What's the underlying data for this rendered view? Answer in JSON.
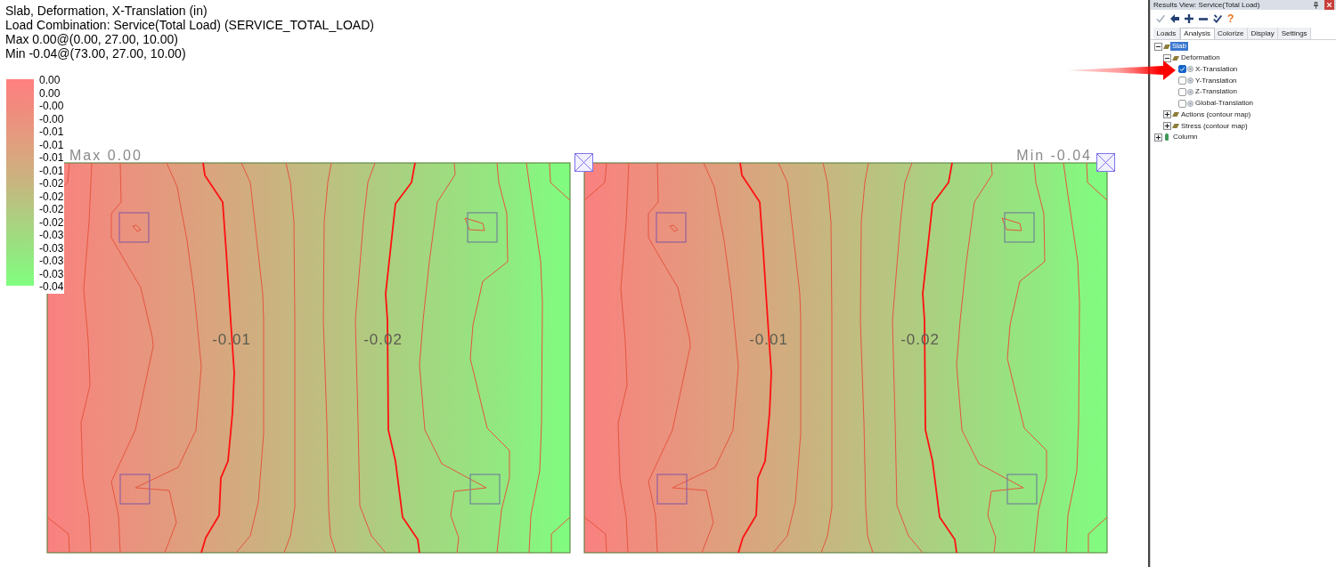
{
  "header": {
    "lines": [
      "Slab, Deformation, X-Translation (in)",
      "Load Combination: Service(Total Load) (SERVICE_TOTAL_LOAD)",
      "Max 0.00@(0.00, 27.00, 10.00)",
      "Min -0.04@(73.00, 27.00, 10.00)"
    ]
  },
  "legend": {
    "labels": [
      "0.00",
      "0.00",
      "-0.00",
      "-0.00",
      "-0.01",
      "-0.01",
      "-0.01",
      "-0.01",
      "-0.02",
      "-0.02",
      "-0.02",
      "-0.02",
      "-0.03",
      "-0.03",
      "-0.03",
      "-0.03",
      "-0.04"
    ]
  },
  "plot": {
    "max_label": "Max 0.00",
    "min_label": "Min -0.04",
    "slabs": [
      {
        "contour_labels": [
          "-0.01",
          "-0.02"
        ]
      },
      {
        "contour_labels": [
          "-0.01",
          "-0.02"
        ]
      }
    ]
  },
  "panel": {
    "title": "Results View: Service(Total Load)",
    "toolbar": [
      {
        "kind": "apply",
        "disabled": true
      },
      {
        "kind": "back",
        "disabled": false
      },
      {
        "kind": "add",
        "disabled": false
      },
      {
        "kind": "remove",
        "disabled": false
      },
      {
        "kind": "verify",
        "disabled": false
      },
      {
        "kind": "help",
        "glyph": "?",
        "disabled": false
      }
    ],
    "tabs": [
      {
        "label": "Loads",
        "selected": false
      },
      {
        "label": "Analysis",
        "selected": true
      },
      {
        "label": "Colorize",
        "selected": false
      },
      {
        "label": "Display",
        "selected": false
      },
      {
        "label": "Settings",
        "selected": false
      }
    ],
    "tree": [
      {
        "label": "Slab",
        "kind": "plate",
        "expanded": true,
        "selected": true,
        "children": [
          {
            "label": "Deformation",
            "kind": "plate",
            "expanded": true,
            "selected": false,
            "children": [
              {
                "label": "X-Translation",
                "kind": "result",
                "checked": true,
                "selected": false
              },
              {
                "label": "Y-Translation",
                "kind": "result",
                "checked": false,
                "selected": false
              },
              {
                "label": "Z-Translation",
                "kind": "result",
                "checked": false,
                "selected": false
              },
              {
                "label": "Global-Translation",
                "kind": "result",
                "checked": false,
                "selected": false
              }
            ]
          },
          {
            "label": "Actions (contour map)",
            "kind": "plate",
            "expanded": false,
            "selected": false
          },
          {
            "label": "Stress (contour map)",
            "kind": "plate",
            "expanded": false,
            "selected": false
          }
        ]
      },
      {
        "label": "Column",
        "kind": "column",
        "expanded": false,
        "selected": false
      }
    ]
  }
}
